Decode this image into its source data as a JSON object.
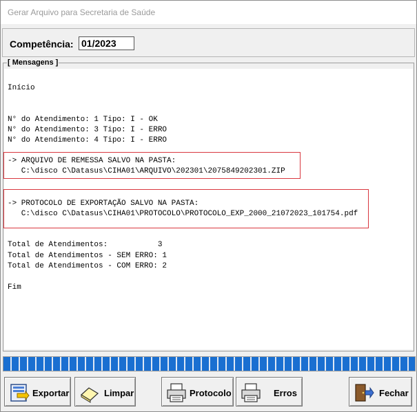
{
  "window": {
    "title": "Gerar Arquivo para Secretaria de Saúde"
  },
  "competencia": {
    "label": "Competência:",
    "value": "01/2023"
  },
  "mensagens": {
    "legend": "[ Mensagens ]",
    "lines": [
      "Início",
      "N° do Atendimento: 1 Tipo: I - OK",
      "N° do Atendimento: 3 Tipo: I - ERRO",
      "N° do Atendimento: 4 Tipo: I - ERRO",
      "-> ARQUIVO DE REMESSA SALVO NA PASTA:",
      "   C:\\disco C\\Datasus\\CIHA01\\ARQUIVO\\202301\\2075849202301.ZIP",
      "-> PROTOCOLO DE EXPORTAÇÃO SALVO NA PASTA:",
      "   C:\\disco C\\Datasus\\CIHA01\\PROTOCOLO\\PROTOCOLO_EXP_2000_21072023_101754.pdf",
      "Total de Atendimentos:           3",
      "Total de Atendimentos - SEM ERRO: 1",
      "Total de Atendimentos - COM ERRO: 2",
      "Fim"
    ]
  },
  "progress": {
    "value": 1.0,
    "color": "#1a6fd1"
  },
  "buttons": {
    "exportar": "Exportar",
    "limpar": "Limpar",
    "protocolo": "Protocolo",
    "erros": "Erros",
    "fechar": "Fechar"
  },
  "icons": {
    "exportar": "export-icon",
    "limpar": "eraser-icon",
    "protocolo": "printer-icon",
    "erros": "printer-icon",
    "fechar": "exit-door-icon"
  },
  "colors": {
    "highlight_box": "#d9363e"
  }
}
